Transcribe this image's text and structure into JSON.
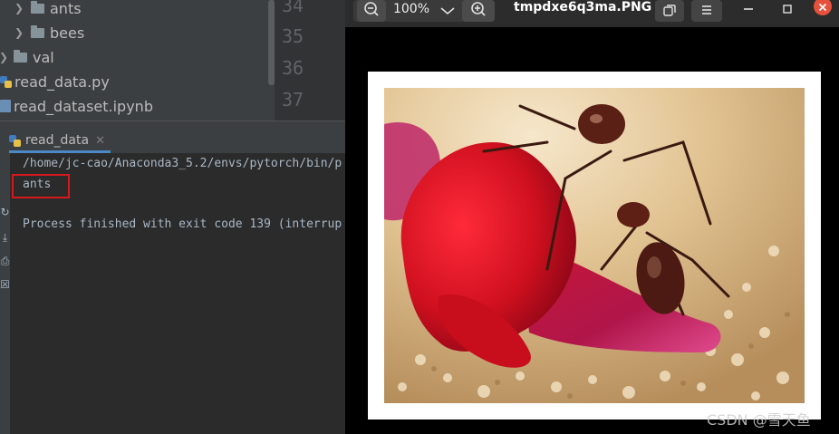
{
  "project_tree": {
    "items": [
      {
        "label": "ants",
        "kind": "folder",
        "expanded": false
      },
      {
        "label": "bees",
        "kind": "folder",
        "expanded": false
      },
      {
        "label": "val",
        "kind": "folder",
        "expanded": false
      },
      {
        "label": "read_data.py",
        "kind": "python-file"
      },
      {
        "label": "read_dataset.ipynb",
        "kind": "notebook-file"
      }
    ]
  },
  "editor": {
    "line_numbers": [
      "34",
      "35",
      "36",
      "37"
    ]
  },
  "run_panel": {
    "tab_label": "read_data",
    "console_lines": [
      "/home/jc-cao/Anaconda3_5.2/envs/pytorch/bin/p",
      "ants",
      "Process finished with exit code 139 (interrup"
    ],
    "highlight_color": "#d6181e"
  },
  "image_viewer": {
    "zoom": "100%",
    "filename": "tmpdxe6q3ma.PNG",
    "photo_subject": "ant on red flower",
    "close_color": "#e5513c"
  },
  "watermark": "CSDN @雪天鱼"
}
